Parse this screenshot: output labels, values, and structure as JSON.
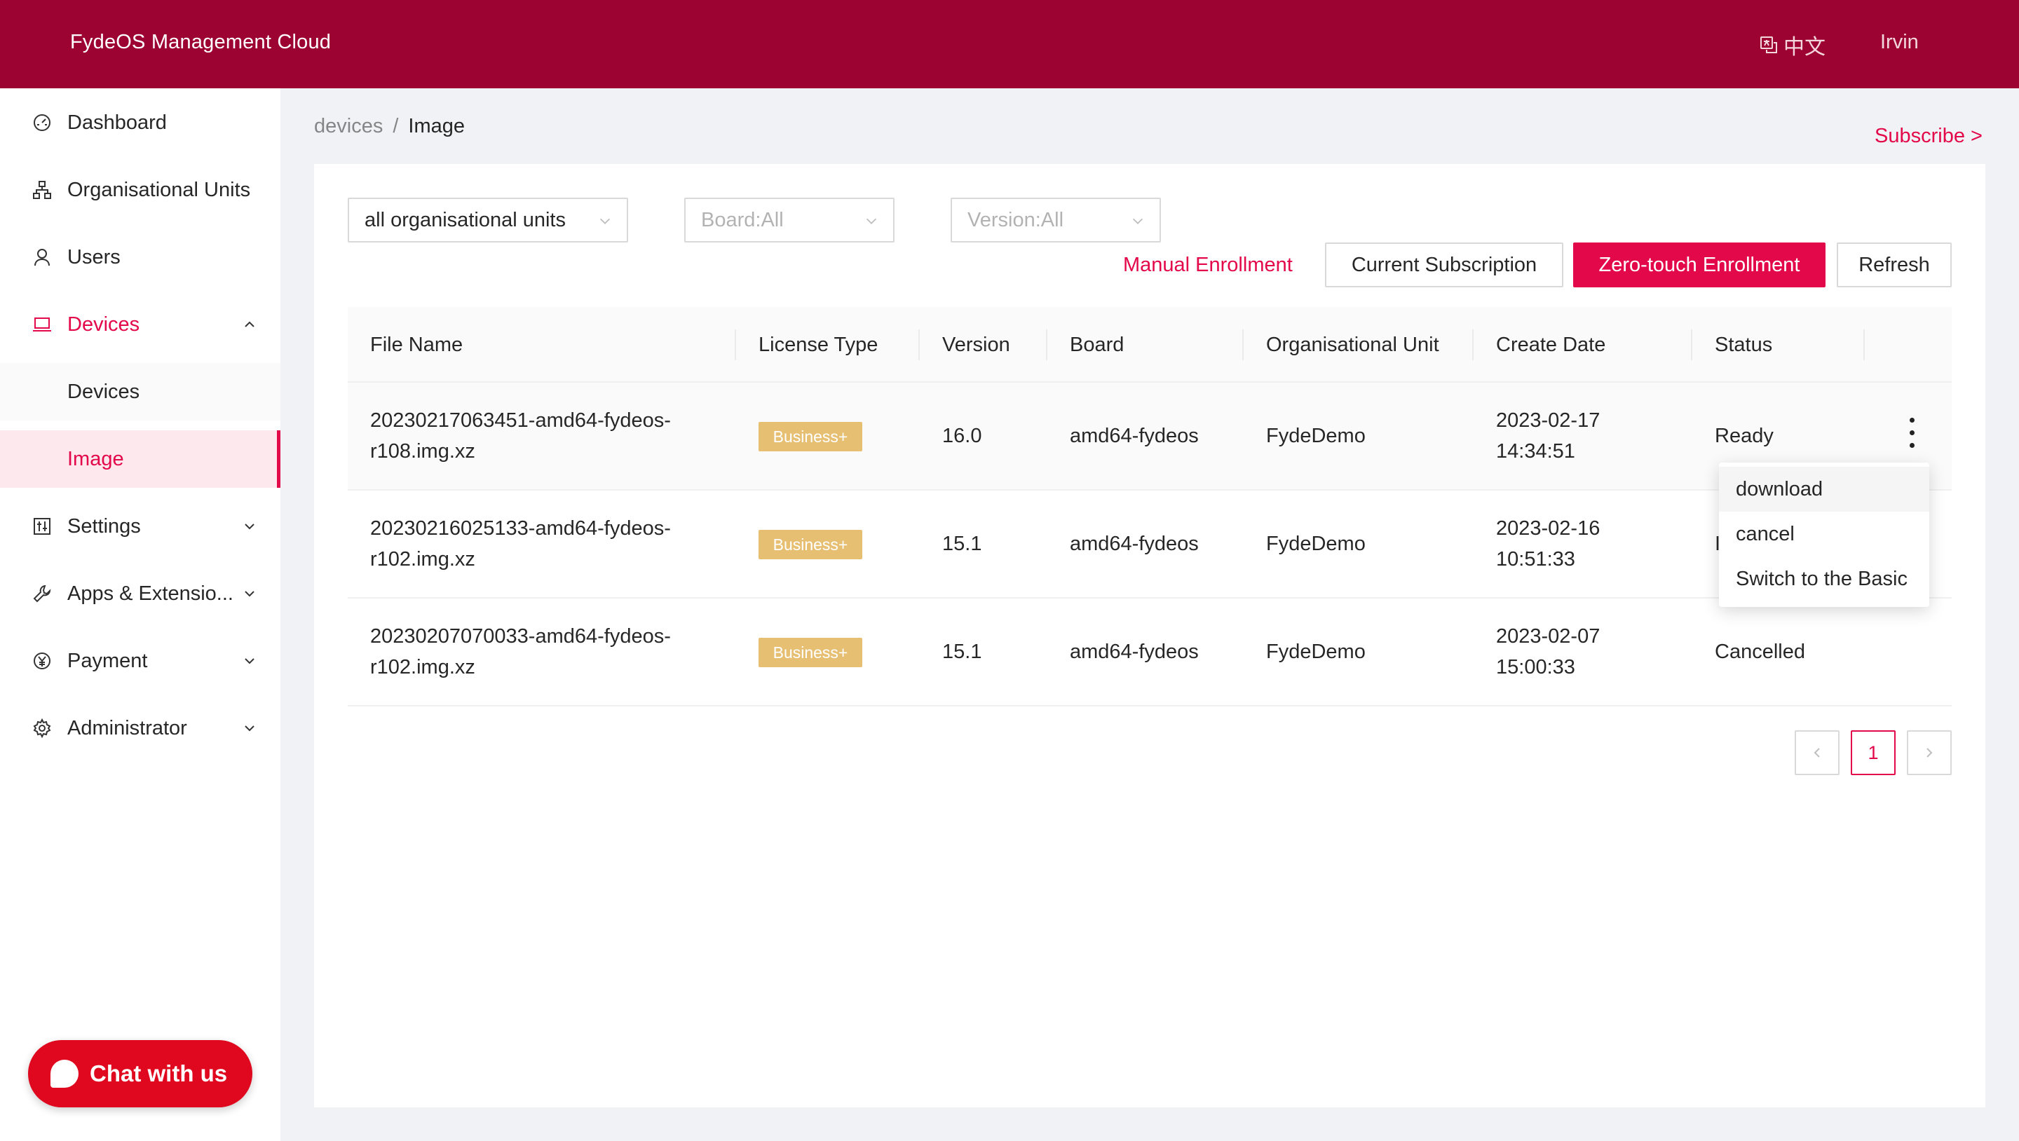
{
  "header": {
    "brand": "FydeOS Management Cloud",
    "language": "中文",
    "user": "Irvin"
  },
  "sidebar": {
    "items": [
      {
        "label": "Dashboard",
        "icon": "dashboard-icon"
      },
      {
        "label": "Organisational Units",
        "icon": "org-tree-icon"
      },
      {
        "label": "Users",
        "icon": "user-icon"
      },
      {
        "label": "Devices",
        "icon": "laptop-icon",
        "expanded": true
      },
      {
        "label": "Devices"
      },
      {
        "label": "Image",
        "selected": true
      },
      {
        "label": "Settings",
        "icon": "settings-sliders-icon"
      },
      {
        "label": "Apps & Extensio...",
        "icon": "wrench-icon"
      },
      {
        "label": "Payment",
        "icon": "yen-circle-icon"
      },
      {
        "label": "Administrator",
        "icon": "gear-icon"
      }
    ],
    "chat_label": "Chat with us"
  },
  "breadcrumb": {
    "parent": "devices",
    "separator": "/",
    "current": "Image"
  },
  "subscribe_link": "Subscribe >",
  "filters": {
    "org_unit": "all organisational units",
    "board": "Board:All",
    "version": "Version:All"
  },
  "actions": {
    "manual_enrollment": "Manual Enrollment",
    "current_subscription": "Current Subscription",
    "zero_touch": "Zero-touch Enrollment",
    "refresh": "Refresh"
  },
  "table": {
    "columns": [
      "File Name",
      "License Type",
      "Version",
      "Board",
      "Organisational Unit",
      "Create Date",
      "Status"
    ],
    "rows": [
      {
        "file_line1": "20230217063451-amd64-fydeos-",
        "file_line2": "r108.img.xz",
        "license": "Business+",
        "version": "16.0",
        "board": "amd64-fydeos",
        "org": "FydeDemo",
        "date": "2023-02-17",
        "time": "14:34:51",
        "status": "Ready"
      },
      {
        "file_line1": "20230216025133-amd64-fydeos-",
        "file_line2": "r102.img.xz",
        "license": "Business+",
        "version": "15.1",
        "board": "amd64-fydeos",
        "org": "FydeDemo",
        "date": "2023-02-16",
        "time": "10:51:33",
        "status": "I"
      },
      {
        "file_line1": "20230207070033-amd64-fydeos-",
        "file_line2": "r102.img.xz",
        "license": "Business+",
        "version": "15.1",
        "board": "amd64-fydeos",
        "org": "FydeDemo",
        "date": "2023-02-07",
        "time": "15:00:33",
        "status": "Cancelled"
      }
    ]
  },
  "row_menu": {
    "items": [
      "download",
      "cancel",
      "Switch to the Basic"
    ]
  },
  "pagination": {
    "current_page": "1"
  },
  "colors": {
    "header_bg": "#9c0232",
    "accent": "#e3084a",
    "badge": "#e6bf72",
    "chat": "#e0081f"
  }
}
